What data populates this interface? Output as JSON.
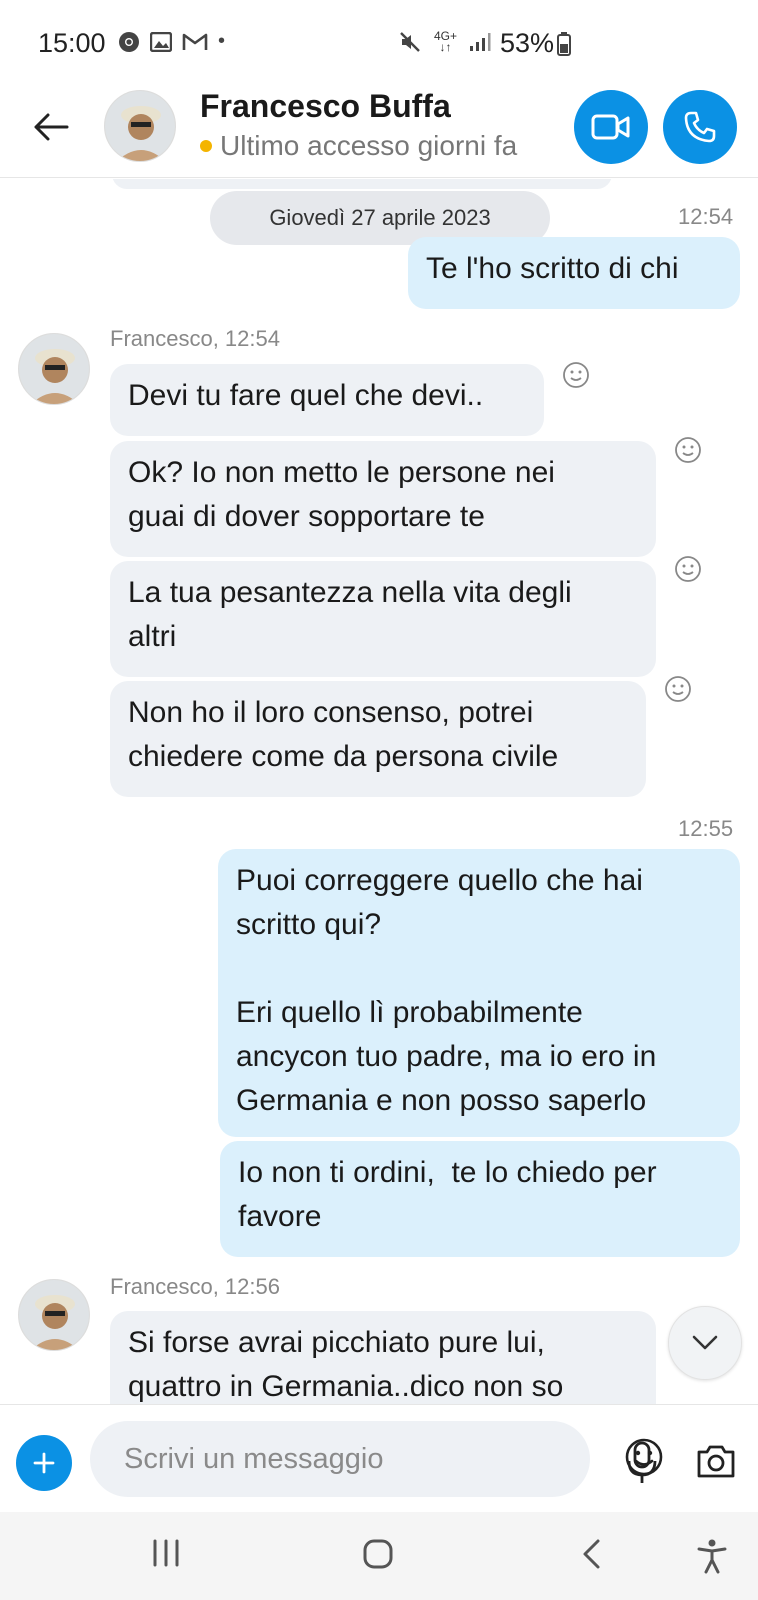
{
  "status_bar": {
    "time": "15:00",
    "dot": "•",
    "network": "4G+",
    "battery": "53%",
    "icons": [
      "chrome-icon",
      "gallery-icon",
      "gmail-icon",
      "mute-icon",
      "network-4g-icon",
      "signal-icon",
      "battery-icon"
    ]
  },
  "header": {
    "contact_name": "Francesco Buffa",
    "status": "Ultimo accesso giorni fa",
    "status_color": "#f4b400",
    "accent": "#0b91e4"
  },
  "chat": {
    "date_separator": "Giovedì 27 aprile 2023",
    "messages": [
      {
        "dir": "out",
        "time": "12:54",
        "text": "Te l'ho scritto di chi"
      },
      {
        "dir": "in",
        "sender": "Francesco, 12:54",
        "text": "Devi tu fare quel che devi.."
      },
      {
        "dir": "in",
        "text": "Ok? Io non metto le persone nei\nguai di dover sopportare te"
      },
      {
        "dir": "in",
        "text": "La tua pesantezza nella vita degli\naltri"
      },
      {
        "dir": "in",
        "text": "Non ho il loro consenso, potrei\nchiedere come da persona civile"
      },
      {
        "dir": "out",
        "time": "12:55",
        "text": "Puoi correggere quello che hai\nscritto qui?\n\nEri quello lì probabilmente\nancycon tuo padre, ma io ero in\nGermania e non posso saperlo"
      },
      {
        "dir": "out",
        "text": "Io non ti ordini,  te lo chiedo per\nfavore"
      },
      {
        "dir": "in",
        "sender": "Francesco, 12:56",
        "text": "Si forse avrai picchiato pure lui,\nquattro in Germania..dico non so"
      }
    ]
  },
  "composer": {
    "placeholder": "Scrivi un messaggio"
  }
}
